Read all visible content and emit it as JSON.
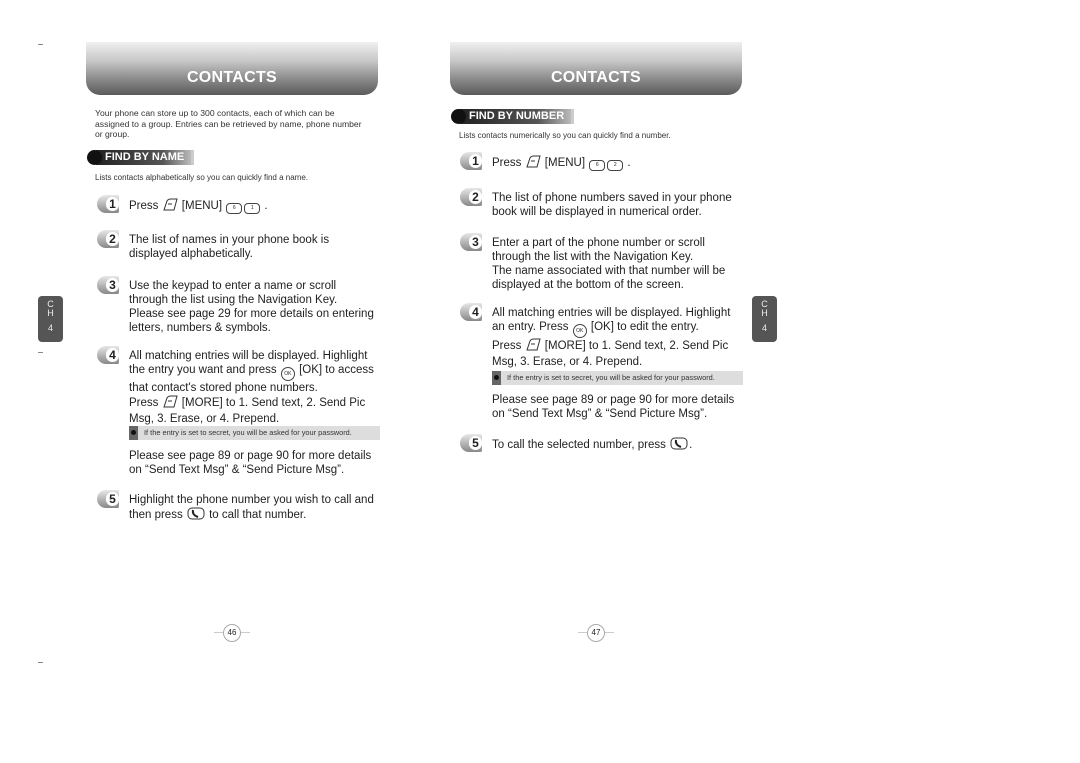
{
  "left": {
    "header": "CONTACTS",
    "intro": "Your phone can store up to 300 contacts, each of which can be assigned to a group. Entries can be retrieved by name, phone number or group.",
    "section_title": "FIND BY NAME",
    "section_sub": "Lists contacts alphabetically so you can quickly find a name.",
    "chapter_tab": {
      "letters": "C H",
      "number": "4"
    },
    "page_number": "46",
    "steps": [
      {
        "num": "1",
        "lines": [
          [
            {
              "t": "Press "
            },
            {
              "icon": "menu-softkey-icon"
            },
            {
              "t": " [MENU] "
            },
            {
              "key": "6"
            },
            {
              "key": "1"
            },
            {
              "t": " ."
            }
          ]
        ]
      },
      {
        "num": "2",
        "lines": [
          [
            {
              "t": "The list of names in your phone book is"
            }
          ],
          [
            {
              "t": "displayed alphabetically."
            }
          ]
        ]
      },
      {
        "num": "3",
        "lines": [
          [
            {
              "t": "Use the keypad to enter a name or scroll"
            }
          ],
          [
            {
              "t": "through the list using the Navigation Key."
            }
          ],
          [
            {
              "t": "Please see page 29 for more details on entering"
            }
          ],
          [
            {
              "t": "letters, numbers & symbols."
            }
          ]
        ]
      },
      {
        "num": "4",
        "lines": [
          [
            {
              "t": "All matching entries will be displayed. Highlight"
            }
          ],
          [
            {
              "t": "the entry you want and press "
            },
            {
              "ok": "OK"
            },
            {
              "t": " [OK] to access"
            }
          ],
          [
            {
              "t": "that contact's stored phone numbers."
            }
          ],
          [
            {
              "t": "Press "
            },
            {
              "icon": "menu-softkey-icon"
            },
            {
              "t": " [MORE] to 1. Send text, 2. Send Pic"
            }
          ],
          [
            {
              "t": "Msg, 3. Erase, or 4. Prepend."
            }
          ]
        ]
      },
      {
        "num": "",
        "lines": [
          [
            {
              "t": "Please see page 89 or page 90 for more details"
            }
          ],
          [
            {
              "t": "on “Send Text Msg” & “Send Picture Msg”."
            }
          ]
        ]
      },
      {
        "num": "5",
        "lines": [
          [
            {
              "t": "Highlight the phone number you wish to call and"
            }
          ],
          [
            {
              "t": "then press "
            },
            {
              "icon": "send-key-icon"
            },
            {
              "t": " to call that number."
            }
          ]
        ]
      }
    ],
    "note": "If the entry is set to secret, you will be asked for your password."
  },
  "right": {
    "header": "CONTACTS",
    "section_title": "FIND BY NUMBER",
    "section_sub": "Lists contacts numerically so you can quickly find a number.",
    "chapter_tab": {
      "letters": "C H",
      "number": "4"
    },
    "page_number": "47",
    "steps": [
      {
        "num": "1",
        "lines": [
          [
            {
              "t": "Press "
            },
            {
              "icon": "menu-softkey-icon"
            },
            {
              "t": " [MENU] "
            },
            {
              "key": "6"
            },
            {
              "key": "2"
            },
            {
              "t": " ."
            }
          ]
        ]
      },
      {
        "num": "2",
        "lines": [
          [
            {
              "t": "The list of phone numbers saved in your phone"
            }
          ],
          [
            {
              "t": "book will be displayed in numerical order."
            }
          ]
        ]
      },
      {
        "num": "3",
        "lines": [
          [
            {
              "t": "Enter a part of the phone number or scroll"
            }
          ],
          [
            {
              "t": "through the list with the Navigation Key."
            }
          ],
          [
            {
              "t": "The name associated with that number will be"
            }
          ],
          [
            {
              "t": "displayed at the bottom of the screen."
            }
          ]
        ]
      },
      {
        "num": "4",
        "lines": [
          [
            {
              "t": "All matching entries will be displayed. Highlight"
            }
          ],
          [
            {
              "t": "an entry. Press "
            },
            {
              "ok": "OK"
            },
            {
              "t": " [OK] to edit the entry."
            }
          ],
          [
            {
              "t": "Press "
            },
            {
              "icon": "menu-softkey-icon"
            },
            {
              "t": " [MORE] to 1. Send text, 2. Send Pic"
            }
          ],
          [
            {
              "t": "Msg, 3. Erase, or 4. Prepend."
            }
          ]
        ]
      },
      {
        "num": "",
        "lines": [
          [
            {
              "t": "Please see page 89 or page 90 for more details"
            }
          ],
          [
            {
              "t": "on “Send Text Msg” & “Send Picture Msg”."
            }
          ]
        ]
      },
      {
        "num": "5",
        "lines": [
          [
            {
              "t": "To call the selected number, press "
            },
            {
              "icon": "send-key-icon"
            },
            {
              "t": "."
            }
          ]
        ]
      }
    ],
    "note": "If the entry is set to secret, you will be asked for your password."
  }
}
